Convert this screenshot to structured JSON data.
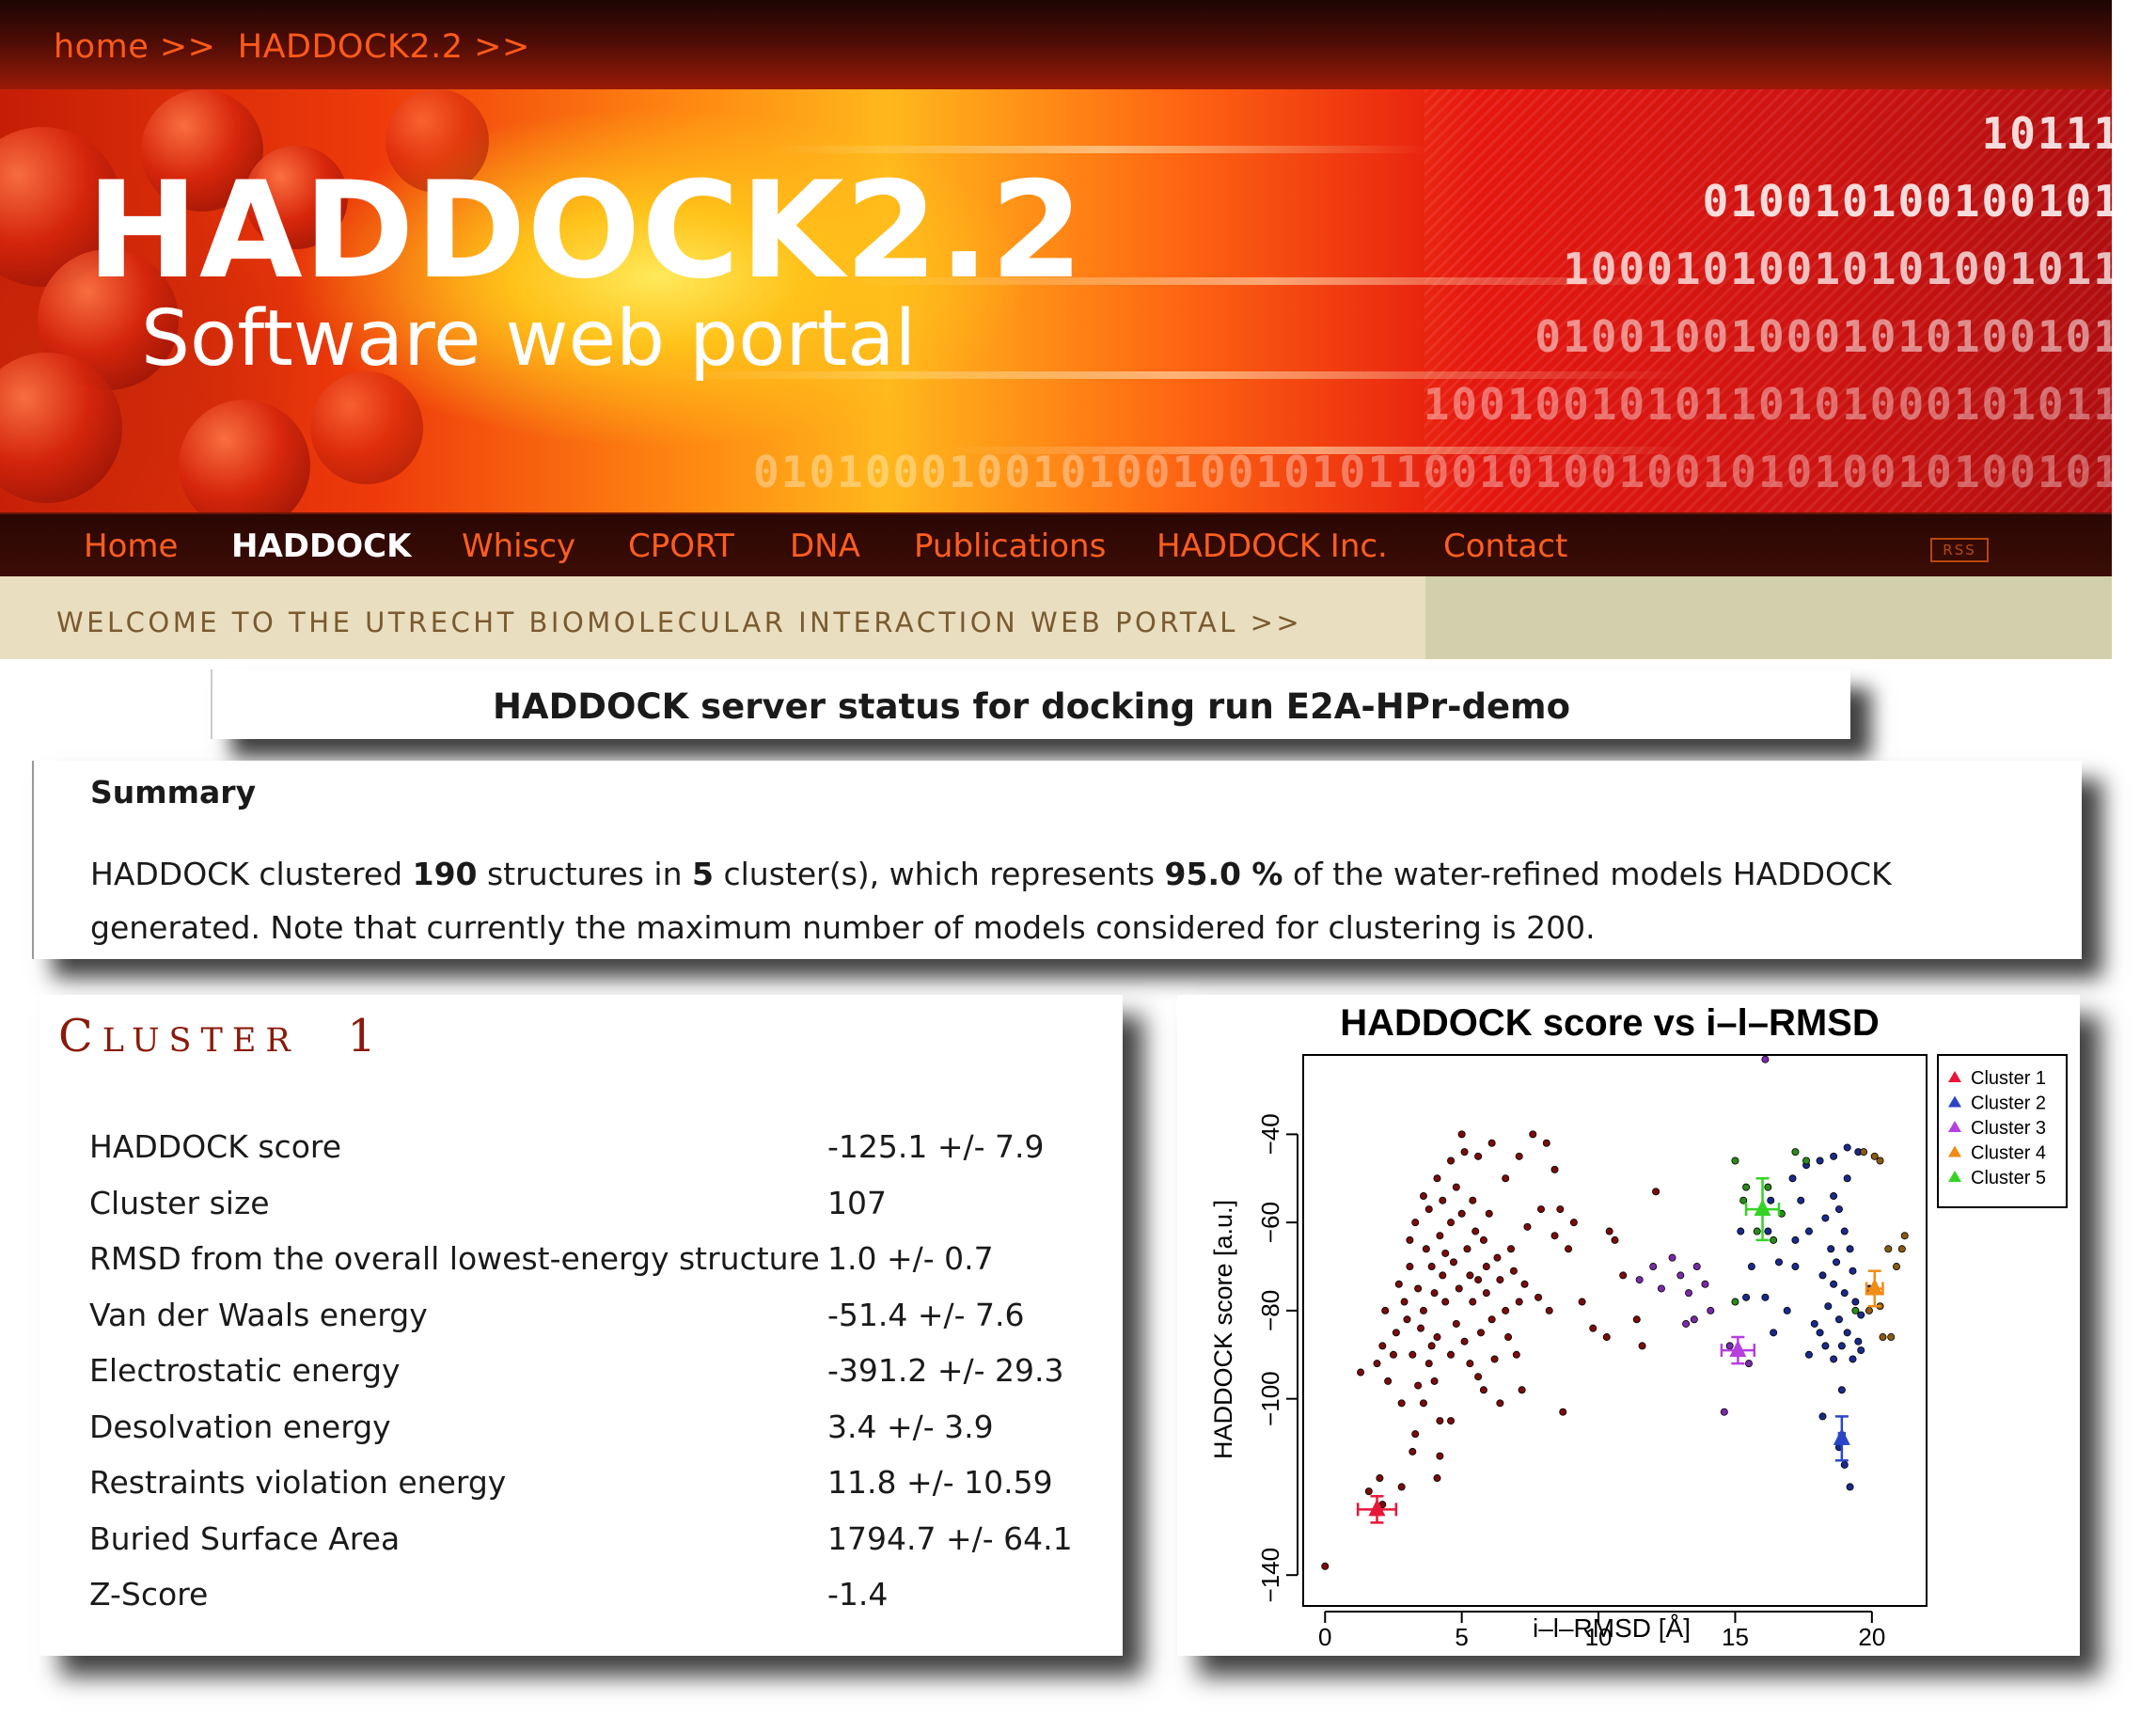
{
  "breadcrumb": {
    "text": "home >>  HADDOCK2.2 >>"
  },
  "banner": {
    "title": "HADDOCK2.2",
    "subtitle": "Software web portal",
    "binary_lines": [
      "10111",
      "010010100100101",
      "10001010010101001011",
      "010010010001010100101",
      "1001001010110101000101011",
      "0101000100101001001010110010100100101010010100101"
    ]
  },
  "nav": {
    "items": [
      "Home",
      "HADDOCK",
      "Whiscy",
      "CPORT",
      "DNA",
      "Publications",
      "HADDOCK Inc.",
      "Contact"
    ],
    "active": "HADDOCK",
    "rss_label": "RSS"
  },
  "welcome": {
    "text": "WELCOME TO THE UTRECHT BIOMOLECULAR INTERACTION WEB PORTAL >>"
  },
  "status": {
    "title": "HADDOCK server status for docking run E2A-HPr-demo"
  },
  "summary": {
    "heading": "Summary",
    "text_1": "HADDOCK clustered ",
    "structures": "190",
    "text_2": " structures in ",
    "clusters": "5",
    "text_3": " cluster(s), which represents ",
    "percent": "95.0 %",
    "text_4": " of the water-refined models HADDOCK generated. Note that currently the maximum number of models considered for clustering is 200."
  },
  "cluster": {
    "title_first": "C",
    "title_rest": "LUSTER",
    "title_number": "1",
    "stats": [
      {
        "label": "HADDOCK score",
        "value": "-125.1 +/- 7.9"
      },
      {
        "label": "Cluster size",
        "value": "107"
      },
      {
        "label": "RMSD from the overall lowest-energy structure",
        "value": "1.0 +/- 0.7"
      },
      {
        "label": "Van der Waals energy",
        "value": "-51.4 +/- 7.6"
      },
      {
        "label": "Electrostatic energy",
        "value": "-391.2 +/- 29.3"
      },
      {
        "label": "Desolvation energy",
        "value": "3.4 +/- 3.9"
      },
      {
        "label": "Restraints violation energy",
        "value": "11.8 +/- 10.59"
      },
      {
        "label": "Buried Surface Area",
        "value": "1794.7 +/- 64.1"
      },
      {
        "label": "Z-Score",
        "value": "-1.4"
      }
    ]
  },
  "colors": {
    "cluster_title": "#8a1a0a",
    "nav_text": "#ff5d20",
    "scatter_points": "#7a0c0c",
    "cluster_1": "#e8173a",
    "cluster_2": "#2a45c8",
    "cluster_3": "#b63fe0",
    "cluster_4": "#f08c14",
    "cluster_5": "#35d424"
  },
  "chart_data": {
    "type": "scatter",
    "title": "HADDOCK score vs i–l–RMSD",
    "xlabel": "i–l–RMSD [Å]",
    "ylabel": "HADDOCK score [a.u.]",
    "xlim": [
      -0.8,
      22
    ],
    "ylim": [
      -147,
      -22
    ],
    "xticks": [
      0,
      5,
      10,
      15,
      20
    ],
    "yticks": [
      -40,
      -60,
      -80,
      -100,
      -140
    ],
    "ytick_labels": [
      "−40",
      "−60",
      "−80",
      "−100",
      "−140"
    ],
    "legend_position": "right, outside plot",
    "legend": [
      "Cluster 1",
      "Cluster 2",
      "Cluster 3",
      "Cluster 4",
      "Cluster 5"
    ],
    "cluster_means": [
      {
        "name": "Cluster 1",
        "x": 1.9,
        "y": -125.1,
        "x_err": 0.7,
        "y_err": 3
      },
      {
        "name": "Cluster 2",
        "x": 18.9,
        "y": -109,
        "x_err": 0.1,
        "y_err": 5
      },
      {
        "name": "Cluster 3",
        "x": 15.1,
        "y": -89,
        "x_err": 0.6,
        "y_err": 3
      },
      {
        "name": "Cluster 4",
        "x": 20.1,
        "y": -75,
        "x_err": 0.3,
        "y_err": 4
      },
      {
        "name": "Cluster 5",
        "x": 16,
        "y": -57,
        "x_err": 0.6,
        "y_err": 7
      }
    ],
    "points": [
      {
        "series": "Cluster 1",
        "xy": [
          [
            0,
            -138
          ],
          [
            1.6,
            -121
          ],
          [
            2,
            -118
          ],
          [
            2.1,
            -124
          ],
          [
            2.8,
            -120
          ],
          [
            3.3,
            -108
          ],
          [
            4.1,
            -118
          ],
          [
            4.2,
            -113
          ],
          [
            4.2,
            -105
          ],
          [
            4.6,
            -105
          ],
          [
            5.6,
            -95
          ],
          [
            6.4,
            -101
          ],
          [
            7.2,
            -98
          ],
          [
            6.2,
            -91
          ],
          [
            3.4,
            -97
          ],
          [
            3.8,
            -92
          ],
          [
            4.1,
            -86
          ],
          [
            4.6,
            -90
          ],
          [
            5.1,
            -87
          ],
          [
            5.7,
            -85
          ],
          [
            6.1,
            -82
          ],
          [
            6.6,
            -80
          ],
          [
            7.1,
            -78
          ],
          [
            3.6,
            -80
          ],
          [
            4,
            -76
          ],
          [
            4.4,
            -78
          ],
          [
            4.9,
            -75
          ],
          [
            5.3,
            -72
          ],
          [
            5.9,
            -70
          ],
          [
            6.3,
            -68
          ],
          [
            3.1,
            -70
          ],
          [
            3.7,
            -66
          ],
          [
            4.2,
            -63
          ],
          [
            4.6,
            -60
          ],
          [
            5,
            -58
          ],
          [
            5.5,
            -62
          ],
          [
            6,
            -58
          ],
          [
            3.6,
            -54
          ],
          [
            4.1,
            -50
          ],
          [
            4.6,
            -46
          ],
          [
            5.1,
            -44
          ],
          [
            5.6,
            -45
          ],
          [
            2.1,
            -88
          ],
          [
            2.6,
            -85
          ],
          [
            3,
            -82
          ],
          [
            1.9,
            -92
          ],
          [
            2.3,
            -96
          ],
          [
            2.8,
            -101
          ],
          [
            6.8,
            -66
          ],
          [
            7.4,
            -61
          ],
          [
            7.9,
            -57
          ],
          [
            8.4,
            -63
          ],
          [
            8.9,
            -66
          ],
          [
            6.6,
            -50
          ],
          [
            7.1,
            -45
          ],
          [
            7.6,
            -40
          ],
          [
            8.1,
            -42
          ],
          [
            8.4,
            -48
          ],
          [
            8.6,
            -57
          ],
          [
            9.1,
            -60
          ],
          [
            9.4,
            -78
          ],
          [
            9.8,
            -84
          ],
          [
            10.3,
            -86
          ],
          [
            10.6,
            -64
          ],
          [
            10.4,
            -62
          ],
          [
            1.3,
            -94
          ],
          [
            2.5,
            -90
          ],
          [
            3.2,
            -90
          ],
          [
            3.9,
            -88
          ],
          [
            4.8,
            -83
          ],
          [
            5.4,
            -78
          ],
          [
            5.9,
            -76
          ],
          [
            6.4,
            -73
          ],
          [
            2.9,
            -78
          ],
          [
            3.4,
            -75
          ],
          [
            4.3,
            -72
          ],
          [
            4.7,
            -69
          ],
          [
            5.2,
            -66
          ],
          [
            5.8,
            -64
          ],
          [
            3.3,
            -60
          ],
          [
            3.8,
            -57
          ],
          [
            4.3,
            -55
          ],
          [
            4.8,
            -52
          ],
          [
            5.4,
            -55
          ],
          [
            3.9,
            -70
          ],
          [
            4.4,
            -67
          ],
          [
            5.6,
            -73
          ],
          [
            6.9,
            -71
          ],
          [
            7.3,
            -74
          ],
          [
            7.8,
            -77
          ],
          [
            8.2,
            -80
          ],
          [
            5,
            -40
          ],
          [
            6.1,
            -42
          ],
          [
            3.5,
            -84
          ],
          [
            4,
            -96
          ],
          [
            5.3,
            -92
          ],
          [
            2.2,
            -80
          ],
          [
            2.7,
            -74
          ],
          [
            3.1,
            -64
          ],
          [
            6.7,
            -86
          ],
          [
            7,
            -90
          ],
          [
            3.6,
            -101
          ],
          [
            3.2,
            -112
          ],
          [
            5.8,
            -98
          ],
          [
            12.1,
            -53
          ],
          [
            10.9,
            -72
          ],
          [
            11.4,
            -82
          ],
          [
            8.7,
            -103
          ],
          [
            11.6,
            -88
          ]
        ]
      },
      {
        "series": "Cluster 2",
        "xy": [
          [
            15.2,
            -62
          ],
          [
            16.3,
            -55
          ],
          [
            17.1,
            -50
          ],
          [
            17.6,
            -47
          ],
          [
            18.1,
            -46
          ],
          [
            18.6,
            -45
          ],
          [
            19.1,
            -43
          ],
          [
            19.5,
            -44
          ],
          [
            17.7,
            -62
          ],
          [
            18.3,
            -59
          ],
          [
            18.8,
            -57
          ],
          [
            19,
            -62
          ],
          [
            19.2,
            -66
          ],
          [
            18.5,
            -66
          ],
          [
            18.7,
            -69
          ],
          [
            19.3,
            -71
          ],
          [
            18.2,
            -72
          ],
          [
            18.6,
            -74
          ],
          [
            19,
            -76
          ],
          [
            19.4,
            -78
          ],
          [
            19.6,
            -81
          ],
          [
            18.4,
            -79
          ],
          [
            18.8,
            -82
          ],
          [
            19.1,
            -85
          ],
          [
            19.5,
            -87
          ],
          [
            18.1,
            -85
          ],
          [
            18.9,
            -88
          ],
          [
            19.3,
            -91
          ],
          [
            17.9,
            -83
          ],
          [
            18.6,
            -91
          ],
          [
            16.2,
            -62
          ],
          [
            16.6,
            -69
          ],
          [
            17.2,
            -64
          ],
          [
            18.2,
            -104
          ],
          [
            18.8,
            -111
          ],
          [
            19,
            -115
          ],
          [
            19.2,
            -120
          ],
          [
            18.6,
            -54
          ],
          [
            17.4,
            -55
          ],
          [
            16.9,
            -80
          ],
          [
            16.1,
            -77
          ],
          [
            16.4,
            -85
          ],
          [
            17.7,
            -90
          ],
          [
            15.6,
            -70
          ],
          [
            15.4,
            -77
          ],
          [
            17.2,
            -70
          ],
          [
            18.3,
            -88
          ],
          [
            18.9,
            -98
          ],
          [
            19.6,
            -89
          ],
          [
            19.9,
            -75
          ],
          [
            19.1,
            -50
          ]
        ]
      },
      {
        "series": "Cluster 3",
        "xy": [
          [
            11.5,
            -73
          ],
          [
            12,
            -70
          ],
          [
            12.3,
            -75
          ],
          [
            12.7,
            -68
          ],
          [
            13,
            -72
          ],
          [
            13.3,
            -76
          ],
          [
            13.6,
            -70
          ],
          [
            13.9,
            -74
          ],
          [
            14.1,
            -80
          ],
          [
            13.2,
            -83
          ],
          [
            13.5,
            -82
          ],
          [
            14.8,
            -88
          ],
          [
            15.5,
            -92
          ],
          [
            14.6,
            -103
          ],
          [
            16.1,
            -23
          ]
        ]
      },
      {
        "series": "Cluster 4",
        "xy": [
          [
            19.7,
            -44
          ],
          [
            20.1,
            -45
          ],
          [
            20.3,
            -46
          ],
          [
            20.6,
            -66
          ],
          [
            20.9,
            -70
          ],
          [
            21.2,
            -63
          ],
          [
            20.4,
            -86
          ],
          [
            20.7,
            -86
          ],
          [
            20.3,
            -79
          ],
          [
            19.9,
            -80
          ],
          [
            21.1,
            -66
          ]
        ]
      },
      {
        "series": "Cluster 5",
        "xy": [
          [
            15,
            -46
          ],
          [
            15.4,
            -52
          ],
          [
            16.2,
            -52
          ],
          [
            16.7,
            -58
          ],
          [
            15.8,
            -62
          ],
          [
            17.2,
            -44
          ],
          [
            15,
            -78
          ],
          [
            19.4,
            -80
          ],
          [
            16.4,
            -64
          ],
          [
            15.3,
            -55
          ],
          [
            17.6,
            -46
          ]
        ]
      }
    ]
  }
}
